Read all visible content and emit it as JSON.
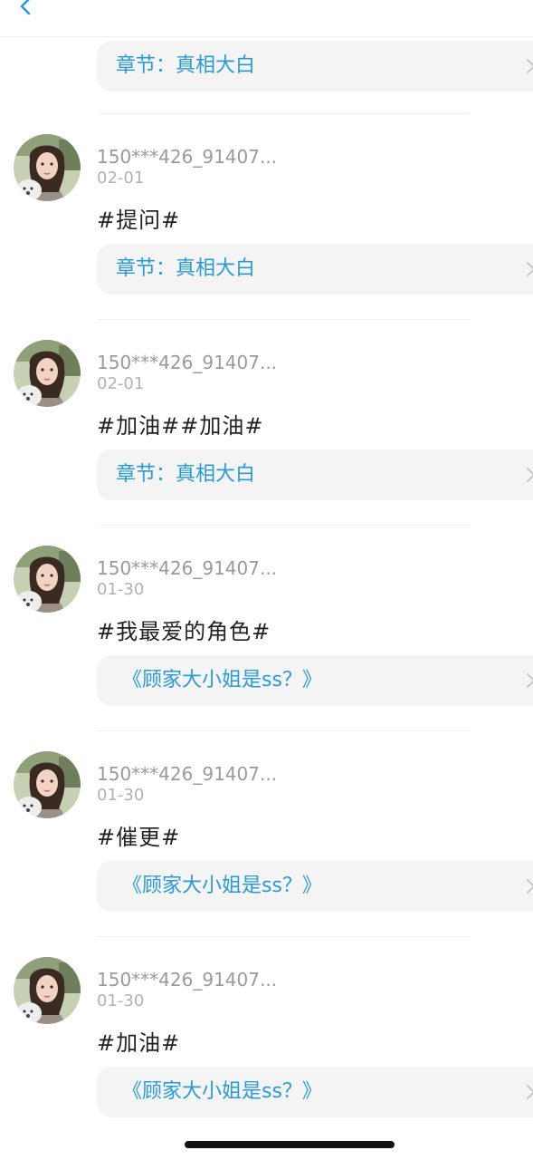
{
  "header": {
    "back_icon": "chevron-left-icon",
    "accent_color": "#2a9ad6"
  },
  "top_card": {
    "label": "章节：真相大白"
  },
  "posts": [
    {
      "username": "150***426_91407...",
      "date": "02-01",
      "content": "#提问#",
      "link_label": "章节：真相大白"
    },
    {
      "username": "150***426_91407...",
      "date": "02-01",
      "content": "#加油##加油#",
      "link_label": "章节：真相大白"
    },
    {
      "username": "150***426_91407...",
      "date": "01-30",
      "content": "#我最爱的角色#",
      "link_label": "《顾家大小姐是ss？》"
    },
    {
      "username": "150***426_91407...",
      "date": "01-30",
      "content": "#催更#",
      "link_label": "《顾家大小姐是ss？》"
    },
    {
      "username": "150***426_91407...",
      "date": "01-30",
      "content": "#加油#",
      "link_label": "《顾家大小姐是ss？》"
    }
  ]
}
